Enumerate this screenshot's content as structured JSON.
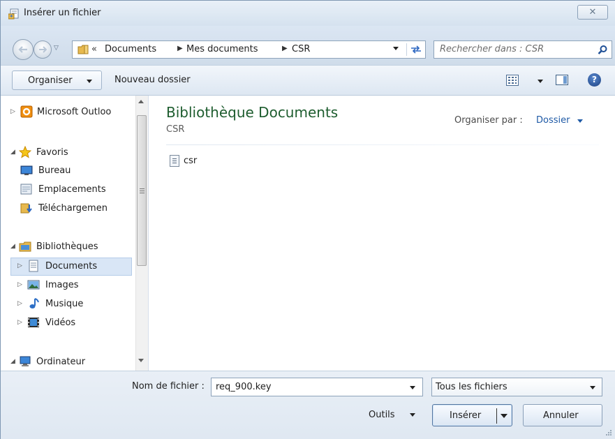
{
  "window": {
    "title": "Insérer un fichier",
    "close_glyph": "✕"
  },
  "nav": {
    "back_icon": "back-arrow-icon",
    "forward_icon": "forward-arrow-icon",
    "recent_glyph": "▽",
    "chevron": "«",
    "breadcrumbs": [
      "Documents",
      "Mes documents",
      "CSR"
    ],
    "separator": "▶"
  },
  "search": {
    "placeholder": "Rechercher dans : CSR"
  },
  "toolbar": {
    "organize_label": "Organiser",
    "new_folder_label": "Nouveau dossier",
    "help_glyph": "?"
  },
  "sidebar": {
    "items": [
      {
        "label": "Microsoft Outloo",
        "icon": "outlook-icon",
        "tri": "▷"
      },
      {
        "label": "Favoris",
        "icon": "star-icon",
        "tri": "◢"
      },
      {
        "label": "Bureau",
        "icon": "desktop-icon"
      },
      {
        "label": "Emplacements",
        "icon": "recent-places-icon"
      },
      {
        "label": "Téléchargemen",
        "icon": "downloads-icon"
      },
      {
        "label": "Bibliothèques",
        "icon": "libraries-icon",
        "tri": "◢"
      },
      {
        "label": "Documents",
        "icon": "documents-icon",
        "tri": "▷"
      },
      {
        "label": "Images",
        "icon": "pictures-icon",
        "tri": "▷"
      },
      {
        "label": "Musique",
        "icon": "music-icon",
        "tri": "▷"
      },
      {
        "label": "Vidéos",
        "icon": "videos-icon",
        "tri": "▷"
      },
      {
        "label": "Ordinateur",
        "icon": "computer-icon",
        "tri": "◢"
      }
    ],
    "scroll_grip": "≡"
  },
  "main": {
    "library_title": "Bibliothèque Documents",
    "library_subtitle": "CSR",
    "arrange_label": "Organiser par :",
    "arrange_value": "Dossier",
    "files": [
      {
        "name": "csr",
        "icon": "text-file-icon"
      }
    ]
  },
  "footer": {
    "filename_label": "Nom de fichier :",
    "filename_value": "req_900.key",
    "filetype_value": "Tous les fichiers",
    "tools_label": "Outils",
    "insert_label": "Insérer",
    "cancel_label": "Annuler"
  },
  "colors": {
    "accent": "#1f5aa6",
    "library_title": "#1e5d2f",
    "selection": "#d9e6f6"
  }
}
